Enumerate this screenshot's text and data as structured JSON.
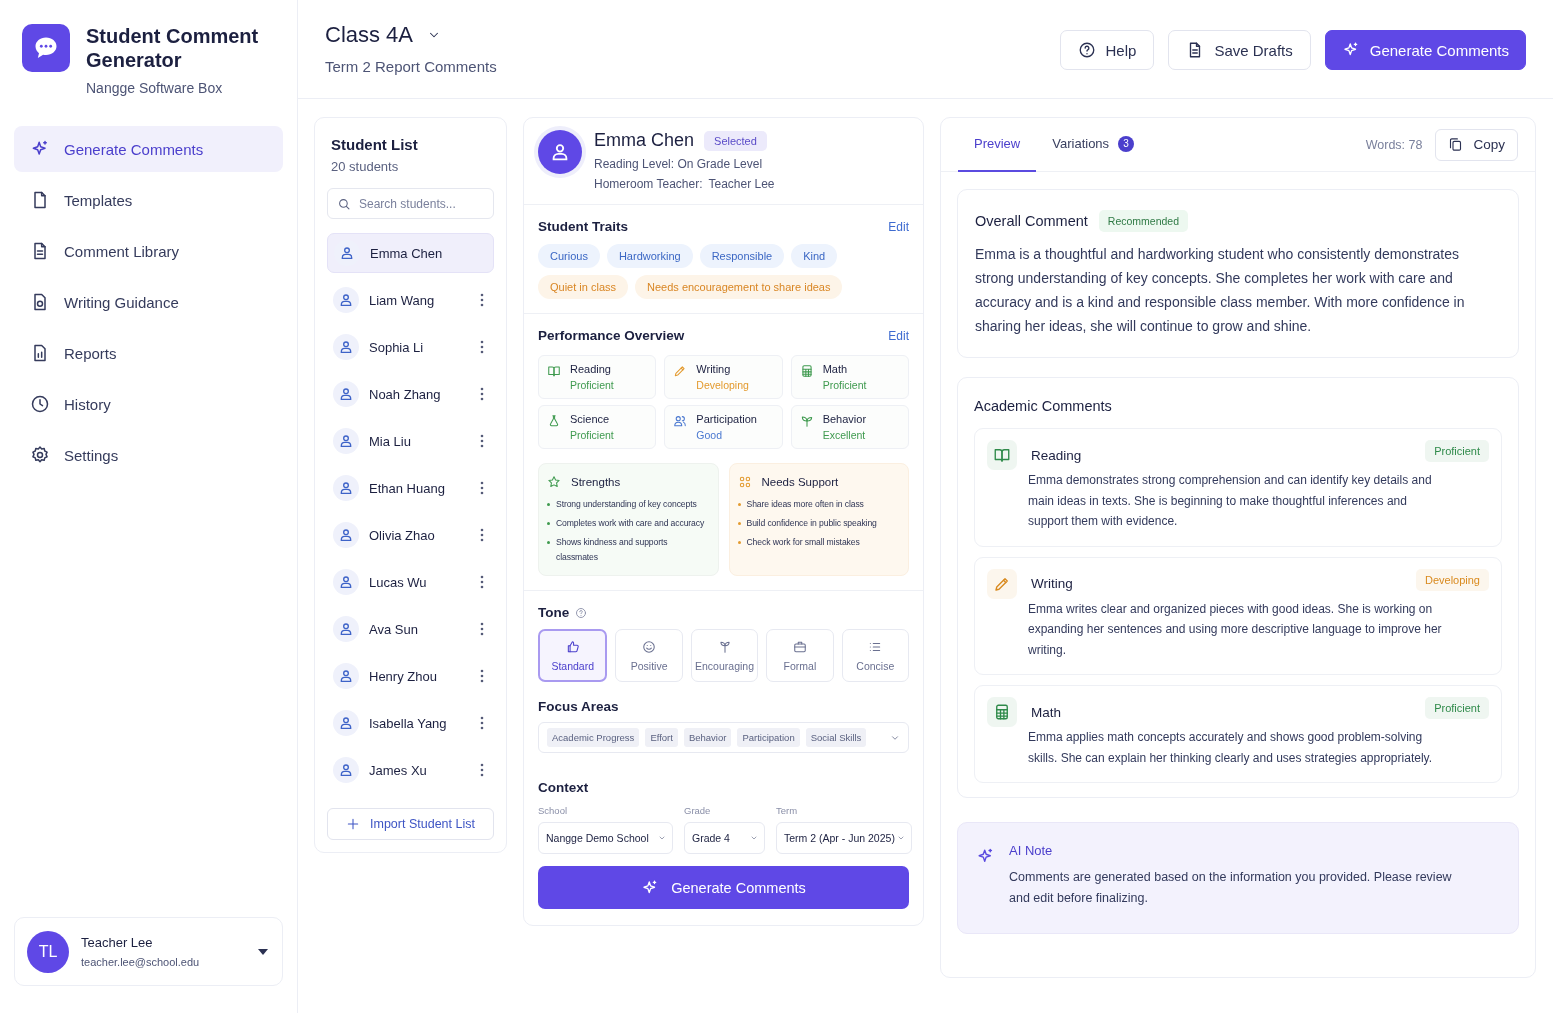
{
  "app": {
    "title": "Student Comment Generator",
    "subtitle": "Nangge Software Box"
  },
  "sidebar": {
    "items": [
      {
        "label": "Generate Comments",
        "selected": true
      },
      {
        "label": "Templates",
        "selected": false
      },
      {
        "label": "Comment Library",
        "selected": false
      },
      {
        "label": "Writing Guidance",
        "selected": false
      },
      {
        "label": "Reports",
        "selected": false
      },
      {
        "label": "History",
        "selected": false
      },
      {
        "label": "Settings",
        "selected": false
      }
    ]
  },
  "user": {
    "initials": "TL",
    "name": "Teacher Lee",
    "email": "teacher.lee@school.edu"
  },
  "header": {
    "title": "Class 4A",
    "subtitle": "Term 2 Report Comments",
    "buttons": [
      {
        "label": "Help",
        "kind": "secondary"
      },
      {
        "label": "Save Drafts",
        "kind": "secondary"
      },
      {
        "label": "Generate Comments",
        "kind": "primary"
      }
    ]
  },
  "student_list": {
    "title": "Student List",
    "count": "20 students",
    "search": {
      "placeholder": "Search students..."
    },
    "students": [
      {
        "name": "Emma Chen",
        "selected": true
      },
      {
        "name": "Liam Wang",
        "selected": false
      },
      {
        "name": "Sophia Li",
        "selected": false
      },
      {
        "name": "Noah Zhang",
        "selected": false
      },
      {
        "name": "Mia Liu",
        "selected": false
      },
      {
        "name": "Ethan Huang",
        "selected": false
      },
      {
        "name": "Olivia Zhao",
        "selected": false
      },
      {
        "name": "Lucas Wu",
        "selected": false
      },
      {
        "name": "Ava Sun",
        "selected": false
      },
      {
        "name": "Henry Zhou",
        "selected": false
      },
      {
        "name": "Isabella Yang",
        "selected": false
      },
      {
        "name": "James Xu",
        "selected": false
      }
    ],
    "import_button": "Import Student List"
  },
  "student": {
    "name": "Emma Chen",
    "badge": "Selected",
    "reading_level": "Reading Level: On Grade Level",
    "teacher_label": "Homeroom Teacher:",
    "teacher": "Teacher Lee"
  },
  "traits": {
    "title": "Student Traits",
    "edit": "Edit",
    "items": [
      {
        "label": "Curious",
        "kind": "positive"
      },
      {
        "label": "Hardworking",
        "kind": "positive"
      },
      {
        "label": "Responsible",
        "kind": "positive"
      },
      {
        "label": "Kind",
        "kind": "positive"
      },
      {
        "label": "Quiet in class",
        "kind": "concern"
      },
      {
        "label": "Needs encouragement to share ideas",
        "kind": "concern"
      }
    ]
  },
  "performance": {
    "title": "Performance Overview",
    "edit": "Edit",
    "items": [
      {
        "subject": "Reading",
        "level": "Proficient",
        "color": "#3f9a4f"
      },
      {
        "subject": "Writing",
        "level": "Developing",
        "color": "#e39a2e"
      },
      {
        "subject": "Math",
        "level": "Proficient",
        "color": "#3f9a4f"
      },
      {
        "subject": "Science",
        "level": "Proficient",
        "color": "#3f9a4f"
      },
      {
        "subject": "Participation",
        "level": "Good",
        "color": "#4a78d0"
      },
      {
        "subject": "Behavior",
        "level": "Excellent",
        "color": "#3f9a4f"
      }
    ]
  },
  "strengths": {
    "title": "Strengths",
    "items": [
      "Strong understanding of key concepts",
      "Completes work with care and accuracy",
      "Shows kindness and supports classmates"
    ]
  },
  "needs_support": {
    "title": "Needs Support",
    "items": [
      "Share ideas more often in class",
      "Build confidence in public speaking",
      "Check work for small mistakes"
    ]
  },
  "tone": {
    "title": "Tone",
    "options": [
      {
        "label": "Standard",
        "selected": true
      },
      {
        "label": "Positive",
        "selected": false
      },
      {
        "label": "Encouraging",
        "selected": false
      },
      {
        "label": "Formal",
        "selected": false
      },
      {
        "label": "Concise",
        "selected": false
      }
    ]
  },
  "focus_areas": {
    "title": "Focus Areas",
    "tags": [
      "Academic Progress",
      "Effort",
      "Behavior",
      "Participation",
      "Social Skills"
    ]
  },
  "context": {
    "title": "Context",
    "fields": [
      {
        "label": "School",
        "value": "Nangge Demo School"
      },
      {
        "label": "Grade",
        "value": "Grade 4"
      },
      {
        "label": "Term",
        "value": "Term 2 (Apr - Jun 2025)"
      }
    ]
  },
  "generate_button": "Generate Comments",
  "preview": {
    "tabs": [
      {
        "label": "Preview",
        "selected": true
      },
      {
        "label": "Variations",
        "badge": "3",
        "selected": false
      }
    ],
    "words": "Words: 78",
    "copy_button": "Copy",
    "overall": {
      "title": "Overall Comment",
      "badge": "Recommended",
      "text": "Emma is a thoughtful and hardworking student who consistently demonstrates strong understanding of key concepts. She completes her work with care and accuracy and is a kind and responsible class member. With more confidence in sharing her ideas, she will continue to grow and shine."
    },
    "academic": {
      "title": "Academic Comments",
      "items": [
        {
          "subject": "Reading",
          "level": "Proficient",
          "color": "#2f8a4a",
          "text": "Emma demonstrates strong comprehension and can identify key details and main ideas in texts. She is beginning to make thoughtful inferences and support them with evidence."
        },
        {
          "subject": "Writing",
          "level": "Developing",
          "color": "#d98a1f",
          "text": "Emma writes clear and organized pieces with good ideas. She is working on expanding her sentences and using more descriptive language to improve her writing."
        },
        {
          "subject": "Math",
          "level": "Proficient",
          "color": "#2f8a4a",
          "text": "Emma applies math concepts accurately and shows good problem-solving skills. She can explain her thinking clearly and uses strategies appropriately."
        }
      ]
    },
    "ai_note": {
      "title": "AI Note",
      "text": "Comments are generated based on the information you provided. Please review and edit before finalizing."
    }
  }
}
